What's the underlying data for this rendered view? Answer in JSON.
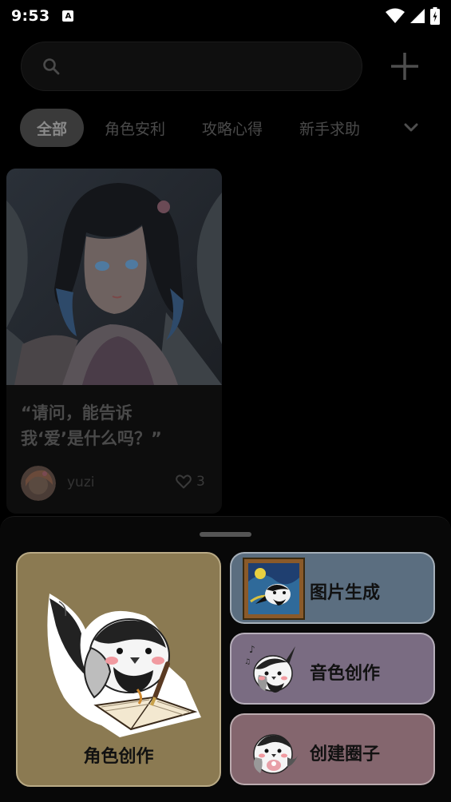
{
  "status_bar": {
    "time": "9:53",
    "notification_icon_letter": "A",
    "icons": [
      "notification-icon",
      "wifi-icon",
      "signal-icon",
      "battery-icon"
    ]
  },
  "search": {
    "placeholder": "",
    "icon": "search-icon"
  },
  "header": {
    "add_icon": "plus-icon"
  },
  "tabs": [
    {
      "label": "全部",
      "active": true
    },
    {
      "label": "角色安利",
      "active": false
    },
    {
      "label": "攻略心得",
      "active": false
    },
    {
      "label": "新手求助",
      "active": false
    }
  ],
  "tabs_more_icon": "chevron-down-icon",
  "posts": [
    {
      "title": "“请问，能告诉\n我‘爱’是什么吗？”",
      "author": "yuzi",
      "likes": "3"
    }
  ],
  "sheet": {
    "features": {
      "character": {
        "label": "角色创作",
        "color": "#8b7a52"
      },
      "image": {
        "label": "图片生成",
        "color": "#5b6e80"
      },
      "voice": {
        "label": "音色创作",
        "color": "#7a6c82"
      },
      "circle": {
        "label": "创建圈子",
        "color": "#84666e"
      }
    }
  }
}
